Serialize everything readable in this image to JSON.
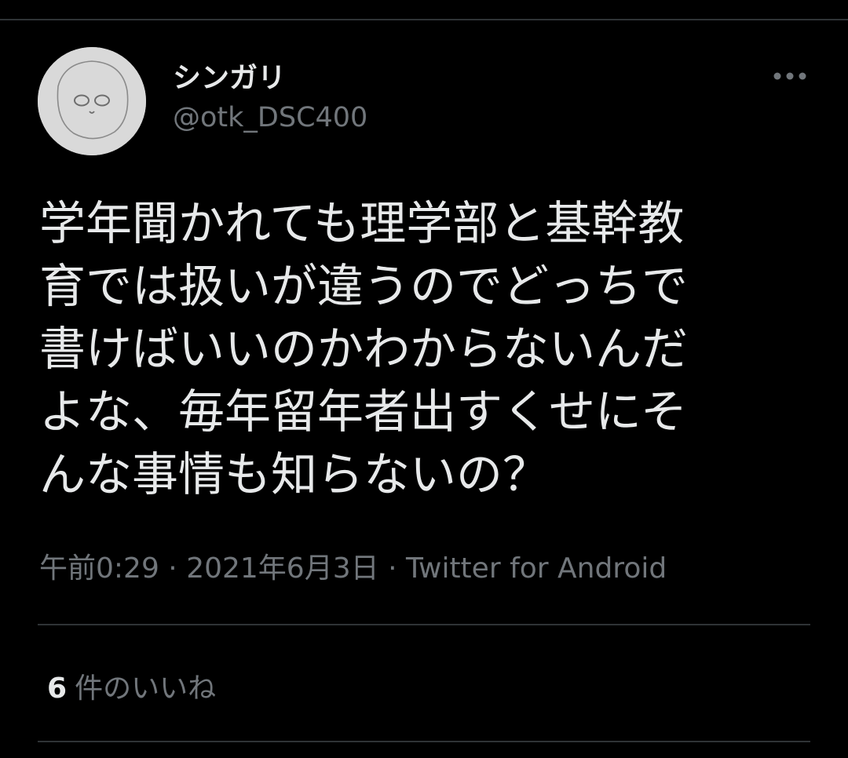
{
  "tweet": {
    "author": {
      "display_name": "シンガリ",
      "handle": "@otk_DSC400"
    },
    "more_icon": "more-horizontal-icon",
    "text_lines": [
      "学年聞かれても理学部と基幹教",
      "育では扱いが違うのでどっちで",
      "書けばいいのかわからないんだ",
      "よな、毎年留年者出すくせにそ",
      "んな事情も知らないの？"
    ],
    "meta": {
      "time": "午前0:29",
      "separator": " · ",
      "date": "2021年6月3日",
      "source": "Twitter for Android"
    },
    "likes": {
      "count": "6",
      "label": "件のいいね"
    }
  },
  "colors": {
    "background": "#000000",
    "text_primary": "#e7e9ea",
    "text_secondary": "#71767b",
    "divider": "#2f3336",
    "avatar_bg": "#d9d9d9"
  }
}
